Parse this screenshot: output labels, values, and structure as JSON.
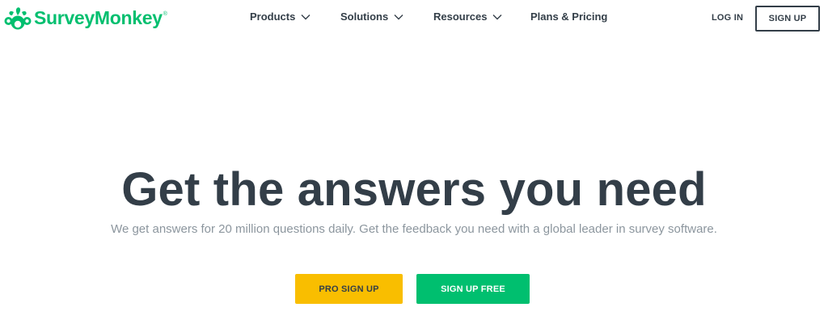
{
  "brand": {
    "name": "SurveyMonkey",
    "trademark": "®",
    "color": "#00bf6f",
    "icon": "monkey-logo-icon"
  },
  "nav": {
    "items": [
      {
        "label": "Products",
        "has_dropdown": true,
        "icon": "chevron-down-icon"
      },
      {
        "label": "Solutions",
        "has_dropdown": true,
        "icon": "chevron-down-icon"
      },
      {
        "label": "Resources",
        "has_dropdown": true,
        "icon": "chevron-down-icon"
      },
      {
        "label": "Plans & Pricing",
        "has_dropdown": false
      }
    ],
    "login_label": "LOG IN",
    "signup_label": "SIGN UP"
  },
  "hero": {
    "title": "Get the answers you need",
    "subtitle": "We get answers for 20 million questions daily. Get the feedback you need with a global leader in survey software.",
    "pro_signup_label": "PRO SIGN UP",
    "free_signup_label": "SIGN UP FREE"
  },
  "colors": {
    "text_dark": "#333e48",
    "text_muted": "#8c969e",
    "accent_green": "#00bf6f",
    "accent_yellow": "#f9be00"
  }
}
